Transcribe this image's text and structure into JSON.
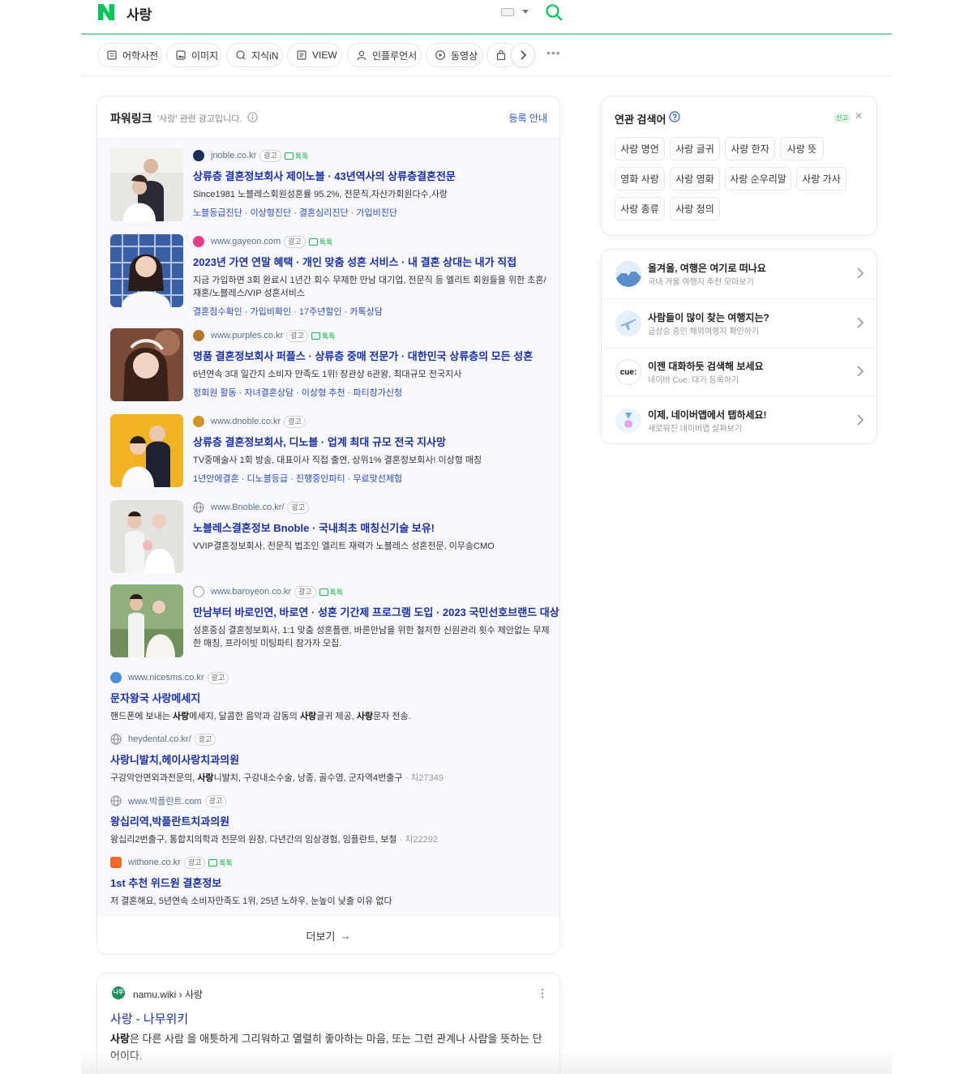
{
  "header": {
    "query": "사랑",
    "logo_icon": "naver-n-logo",
    "brand_color": "#03c75a"
  },
  "tabs": [
    {
      "label": "어학사전",
      "icon": "dictionary-icon"
    },
    {
      "label": "이미지",
      "icon": "image-icon"
    },
    {
      "label": "지식iN",
      "icon": "qna-icon"
    },
    {
      "label": "VIEW",
      "icon": "view-icon"
    },
    {
      "label": "인플루언서",
      "icon": "influencer-icon"
    },
    {
      "label": "동영상",
      "icon": "video-icon"
    },
    {
      "label": "",
      "icon": "shopping-bag-icon"
    }
  ],
  "powerlink": {
    "title": "파워링크",
    "subtitle": "'사랑' 관련 광고입니다.",
    "register": "등록 안내",
    "more": "더보기",
    "ads": [
      {
        "url": "jnoble.co.kr",
        "badge": "광고",
        "talk": "톡톡",
        "title": "상류층 결혼정보회사 제이노블 · 43년역사의 상류층결혼전문",
        "desc": "Since1981 노블레스회원성혼률 95.2%, 전문직,자산가회원다수,사랑",
        "links": "노블등급진단 · 이상형진단 · 결혼심리진단 · 가입비진단"
      },
      {
        "url": "www.gayeon.com",
        "badge": "광고",
        "talk": "톡톡",
        "title": "2023년 가연 연말 혜택 · 개인 맞춤 성혼 서비스 · 내 결혼 상대는 내가 직접",
        "desc": "지금 가입하면 3회 완료시 1년간 회수 무제한 만남 대기업, 전문직 등 엘리트 회원들을 위한 초혼/재혼/노블레스/VIP 성혼서비스",
        "links": "결혼점수확인 · 가입비확인 · 17주년할인 · 카톡상담"
      },
      {
        "url": "www.purples.co.kr",
        "badge": "광고",
        "talk": "톡톡",
        "title": "명품 결혼정보회사 퍼플스 · 상류층 중매 전문가 · 대한민국 상류층의 모든 성혼",
        "desc": "6년연속 3대 일간지 소비자 만족도 1위! 장관상 6관왕, 최대규모 전국지사",
        "links": "정회원 활동 · 자녀결혼상담 · 이상형 추천 · 파티참가신청"
      },
      {
        "url": "www.dnoble.co.kr",
        "badge": "광고",
        "talk": "",
        "title": "상류층 결혼정보회사, 디노블 · 업계 최대 규모 전국 지사망",
        "desc": "TV중매술사 1회 방송, 대표이사 직접 출연, 상위1% 결혼정보회사! 이상형 매칭",
        "links": "1년안에결혼 · 디노블등급 · 진행중인파티 · 무료맞선체험"
      },
      {
        "url": "www.Bnoble.co.kr/",
        "badge": "광고",
        "talk": "",
        "title": "노블레스결혼정보 Bnoble · 국내최초 매칭신기술 보유!",
        "desc": "VVIP결혼정보회사, 전문직 법조인 엘리트 재력가 노블레스 성혼전문, 이무송CMO",
        "links": ""
      },
      {
        "url": "www.baroyeon.co.kr",
        "badge": "광고",
        "talk": "톡톡",
        "title": "만남부터 바로인연, 바로연 · 성혼 기간제 프로그램 도입 · 2023 국민선호브랜드 대상",
        "desc": "성혼중심 결혼정보회사, 1:1 맞춤 성혼플랜, 바른만남을 위한 철저한 신원관리 횟수 제안없는 무제한 매칭, 프라이빗 미팅파티 참가자 모집.",
        "links": ""
      },
      {
        "url": "www.nicesms.co.kr",
        "badge": "광고",
        "talk": "",
        "title": "문자왕국 사랑메세지",
        "desc_parts": [
          "핸드폰에 보내는 ",
          "사랑",
          "메세지, 달콤한 음악과 감동의 ",
          "사랑",
          "글귀 제공, ",
          "사랑",
          "문자 전송."
        ],
        "links": ""
      },
      {
        "url": "heydental.co.kr/",
        "badge": "광고",
        "talk": "",
        "title": "사랑니발치,헤이사랑치과의원",
        "desc_parts": [
          "구강악안면외과전문의, ",
          "사랑",
          "니발치, 구강내소수술, 낭종, 골수염, 군자역4번출구"
        ],
        "desc_extra": " · 치27349",
        "links": ""
      },
      {
        "url": "www.박플란트.com",
        "badge": "광고",
        "talk": "",
        "title": "왕십리역,박플란트치과의원",
        "desc": "왕십리2번출구, 통합치의학과 전문의 원장, 다년간의 임상경험, 임플란트, 보철",
        "desc_extra": " · 치22292",
        "links": ""
      },
      {
        "url": "withone.co.kr",
        "badge": "광고",
        "talk": "톡톡",
        "title": "1st 추천 위드원 결혼정보",
        "desc": "저 결혼해요, 5년연속 소비자만족도 1위, 25년 노하우, 눈높이 낮출 이유 없다",
        "links": ""
      }
    ]
  },
  "wiki": {
    "favicon": "나무",
    "source": "namu.wiki › 사랑",
    "title": "사랑 - 나무위키",
    "desc_bold": "사랑",
    "desc_rest": "은 다른 사람 을 애틋하게 그리워하고 열렬히 좋아하는 마음, 또는 그런 관계나 사람을 뜻하는 단어이다."
  },
  "related": {
    "title": "연관 검색어",
    "report": "신고",
    "keywords": [
      "사랑 명언",
      "사랑 글귀",
      "사랑 한자",
      "사랑 뜻",
      "영화 사랑",
      "사랑 영화",
      "사랑 순우리말",
      "사랑 가사",
      "사랑 종류",
      "사랑 정의"
    ]
  },
  "promos": [
    {
      "title": "올겨울, 여행은 여기로 떠나요",
      "sub": "국내 겨울 여행지 추천 모아보기",
      "icon": "winter-travel-icon"
    },
    {
      "title": "사람들이 많이 찾는 여행지는?",
      "sub": "급상승 중인 해외여행지 확인하기",
      "icon": "airplane-icon"
    },
    {
      "title": "이젠 대화하듯 검색해 보세요",
      "sub": "네이버 Cue: 대기 등록하기",
      "icon": "cue-logo-icon",
      "icon_text": "cue:"
    },
    {
      "title": "이제, 네이버앱에서 탭하세요!",
      "sub": "새로워진 네이버앱 살펴보기",
      "icon": "naver-app-icon"
    }
  ]
}
